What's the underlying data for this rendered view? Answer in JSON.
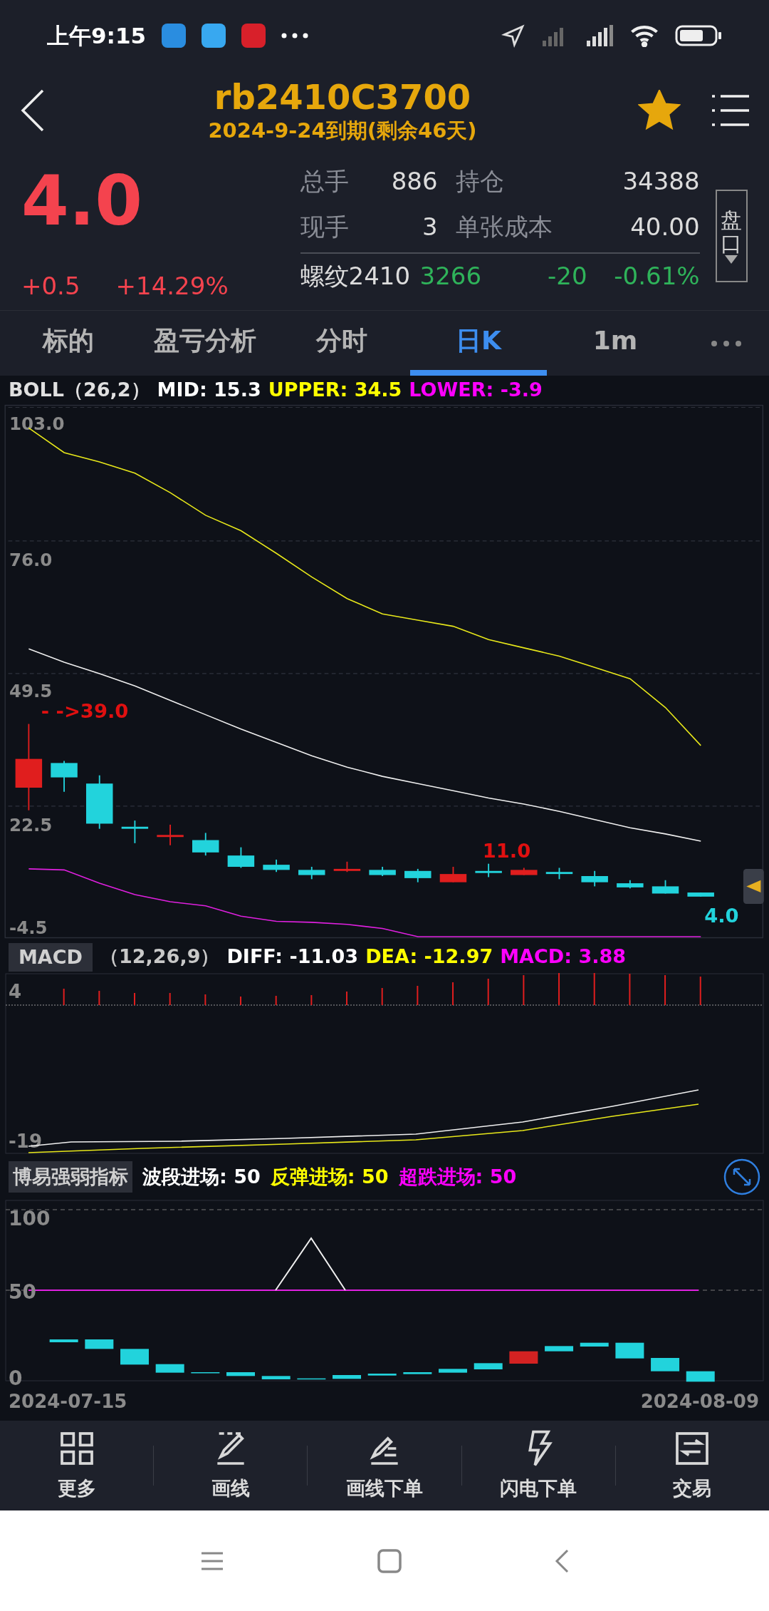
{
  "status_bar": {
    "time": "上午9:15"
  },
  "header": {
    "title": "rb2410C3700",
    "subtitle": "2024-9-24到期(剩余46天)",
    "favorited": true
  },
  "quote": {
    "price": "4.0",
    "change": "+0.5",
    "change_pct": "+14.29%",
    "stats": [
      {
        "label": "总手",
        "value": "886",
        "label_2": "持仓",
        "value_2": "34388"
      },
      {
        "label": "现手",
        "value": "3",
        "label_2": "单张成本",
        "value_2": "40.00"
      }
    ],
    "underlying": {
      "name": "螺纹2410",
      "price": "3266",
      "change": "-20",
      "change_pct": "-0.61%"
    },
    "side_button": "盘口"
  },
  "tabs": [
    {
      "label": "标的",
      "selected": false
    },
    {
      "label": "盈亏分析",
      "selected": false
    },
    {
      "label": "分时",
      "selected": false
    },
    {
      "label": "日K",
      "selected": true
    },
    {
      "label": "1m",
      "selected": false
    }
  ],
  "boll": {
    "legend": [
      {
        "text": "BOLL（26,2）",
        "color": "#e0e0e0"
      },
      {
        "text": "MID: 15.3",
        "color": "#ffffff"
      },
      {
        "text": "UPPER: 34.5",
        "color": "#ffff00"
      },
      {
        "text": "LOWER: -3.9",
        "color": "#ff00ff"
      }
    ],
    "y_labels": [
      "103.0",
      "76.0",
      "49.5",
      "22.5",
      "-4.5"
    ],
    "annotations": [
      {
        "text": "- ->39.0",
        "color": "#e01010"
      },
      {
        "text": "11.0",
        "color": "#e01010"
      },
      {
        "text": "4.0",
        "color": "#22d3dc"
      }
    ]
  },
  "macd": {
    "button": "MACD",
    "legend": [
      {
        "text": "（12,26,9）",
        "color": "#c8c8c8"
      },
      {
        "text": "DIFF: -11.03",
        "color": "#ffffff"
      },
      {
        "text": "DEA: -12.97",
        "color": "#ffff00"
      },
      {
        "text": "MACD: 3.88",
        "color": "#ff00ff"
      }
    ],
    "y_labels": [
      "4",
      "-19"
    ]
  },
  "indicator": {
    "button": "博易强弱指标",
    "legend": [
      {
        "text": "波段进场: 50",
        "color": "#ffffff"
      },
      {
        "text": "反弹进场: 50",
        "color": "#ffff00"
      },
      {
        "text": "超跌进场: 50",
        "color": "#ff00ff"
      }
    ],
    "y_labels": [
      "100",
      "50",
      "0"
    ],
    "dates": [
      "2024-07-15",
      "2024-08-09"
    ]
  },
  "toolbar": [
    {
      "label": "更多",
      "kind": "grid"
    },
    {
      "label": "画线",
      "kind": "pen"
    },
    {
      "label": "画线下单",
      "kind": "pen-lines"
    },
    {
      "label": "闪电下单",
      "kind": "bolt"
    },
    {
      "label": "交易",
      "kind": "swap"
    }
  ]
}
